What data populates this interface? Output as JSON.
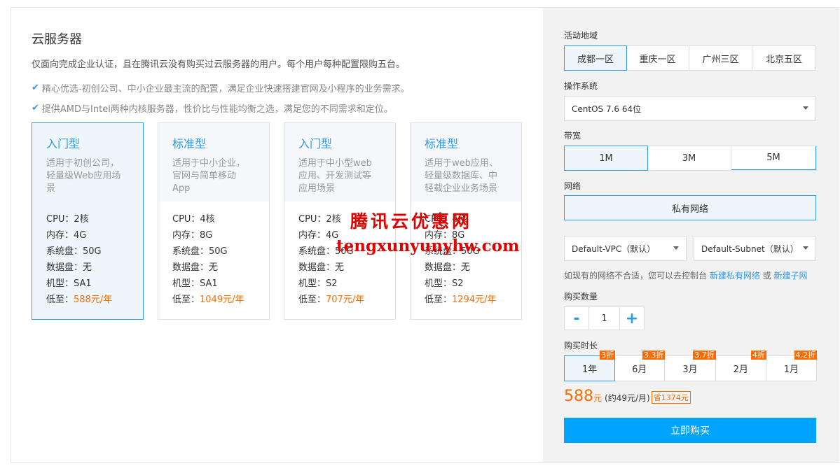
{
  "left": {
    "title": "云服务器",
    "description": "仅面向完成企业认证，且在腾讯云没有购买过云服务器的用户。每个用户每种配置限购五台。",
    "features": [
      "精心优选-初创公司、中小企业最主流的配置，满足企业快速搭建官网及小程序的业务需求。",
      "提供AMD与Intel两种内核服务器，性价比与性能均衡之选，满足您的不同需求和定位。"
    ],
    "check_glyph": "✔",
    "cards": [
      {
        "name": "入门型",
        "desc": [
          "适用于初创公司，",
          "轻量级Web应用场",
          "景"
        ],
        "cpu": "CPU：2核",
        "mem": "内存：4G",
        "sys_disk": "系统盘：50G",
        "data_disk": "数据盘：无",
        "model": "机型：SA1",
        "price_prefix": "低至：",
        "price": "588元/年",
        "active": true
      },
      {
        "name": "标准型",
        "desc": [
          "适用于中小企业，",
          "官网与简单移动",
          "App"
        ],
        "cpu": "CPU：4核",
        "mem": "内存：8G",
        "sys_disk": "系统盘：50G",
        "data_disk": "数据盘：无",
        "model": "机型：SA1",
        "price_prefix": "低至：",
        "price": "1049元/年",
        "active": false
      },
      {
        "name": "入门型",
        "desc": [
          "适用于中小型web",
          "应用、开发测试等",
          "应用场景"
        ],
        "cpu": "CPU：2核",
        "mem": "内存：4G",
        "sys_disk": "系统盘：50G",
        "data_disk": "数据盘：无",
        "model": "机型：S2",
        "price_prefix": "低至：",
        "price": "707元/年",
        "active": false
      },
      {
        "name": "标准型",
        "desc": [
          "适用于web应用、",
          "轻量级数据库、中",
          "轻载企业业务场景"
        ],
        "cpu": "CPU：4核",
        "mem": "内存：8G",
        "sys_disk": "系统盘：50G",
        "data_disk": "数据盘：无",
        "model": "机型：S2",
        "price_prefix": "低至：",
        "price": "1294元/年",
        "active": false
      }
    ],
    "watermark": {
      "line1": "腾讯云优惠网",
      "line2": "tengxunyunyhw.com"
    }
  },
  "right": {
    "region_label": "活动地域",
    "regions": [
      "成都一区",
      "重庆一区",
      "广州三区",
      "北京五区"
    ],
    "os_label": "操作系统",
    "os_value": "CentOS 7.6 64位",
    "bandwidth_label": "带宽",
    "bandwidths": [
      "1M",
      "3M",
      "5M"
    ],
    "network_label": "网络",
    "network_value": "私有网络",
    "vpc_value": "Default-VPC（默认）",
    "subnet_value": "Default-Subnet（默认）",
    "hint_text": "如现有的网络不合适，您可以去控制台 ",
    "hint_link1": "新建私有网络",
    "hint_or": " 或 ",
    "hint_link2": "新建子网",
    "qty_label": "购买数量",
    "qty_minus": "-",
    "qty_value": "1",
    "qty_plus": "+",
    "duration_label": "购买时长",
    "durations": [
      {
        "label": "1年",
        "badge": "3折"
      },
      {
        "label": "6月",
        "badge": "3.3折"
      },
      {
        "label": "3月",
        "badge": "3.7折"
      },
      {
        "label": "2月",
        "badge": "4折"
      },
      {
        "label": "1月",
        "badge": "4.2折"
      }
    ],
    "price": "588",
    "price_unit": "元",
    "monthly": "(约49元/月)",
    "save": "省1374元",
    "buy_label": "立即购买"
  }
}
